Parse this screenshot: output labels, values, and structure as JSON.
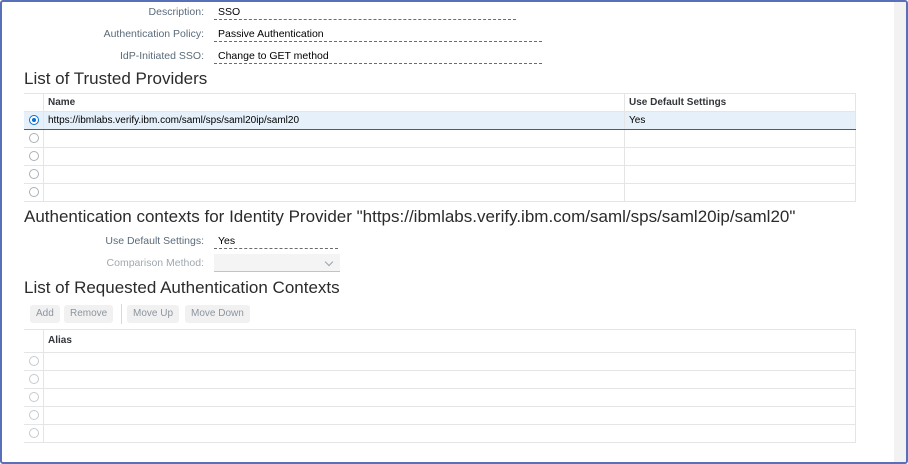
{
  "form": {
    "description_label": "Description:",
    "description_value": "SSO",
    "auth_policy_label": "Authentication Policy:",
    "auth_policy_value": "Passive Authentication",
    "idp_sso_label": "IdP-Initiated SSO:",
    "idp_sso_value": "Change to GET method"
  },
  "trusted_providers": {
    "title": "List of Trusted Providers",
    "columns": [
      "Name",
      "Use Default Settings"
    ],
    "rows": [
      {
        "name": "https://ibmlabs.verify.ibm.com/saml/sps/saml20ip/saml20",
        "use_default": "Yes",
        "selected": true
      },
      {
        "name": "",
        "use_default": "",
        "selected": false
      },
      {
        "name": "",
        "use_default": "",
        "selected": false
      },
      {
        "name": "",
        "use_default": "",
        "selected": false
      },
      {
        "name": "",
        "use_default": "",
        "selected": false
      }
    ]
  },
  "auth_contexts": {
    "title": "Authentication contexts for Identity Provider \"https://ibmlabs.verify.ibm.com/saml/sps/saml20ip/saml20\"",
    "use_default_label": "Use Default Settings:",
    "use_default_value": "Yes",
    "comparison_label": "Comparison Method:",
    "comparison_value": ""
  },
  "requested_contexts": {
    "title": "List of Requested Authentication Contexts",
    "toolbar": {
      "add": "Add",
      "remove": "Remove",
      "move_up": "Move Up",
      "move_down": "Move Down"
    },
    "columns": [
      "Alias"
    ],
    "rows": [
      "",
      "",
      "",
      "",
      ""
    ]
  },
  "colors": {
    "accent": "#0a6ed1",
    "frame_border": "#5a6fb9",
    "selected_row": "#e5f0fa"
  },
  "icons": {
    "radio_selected": "radio-on-icon",
    "radio": "radio-icon",
    "dropdown": "chevron-down-icon"
  }
}
